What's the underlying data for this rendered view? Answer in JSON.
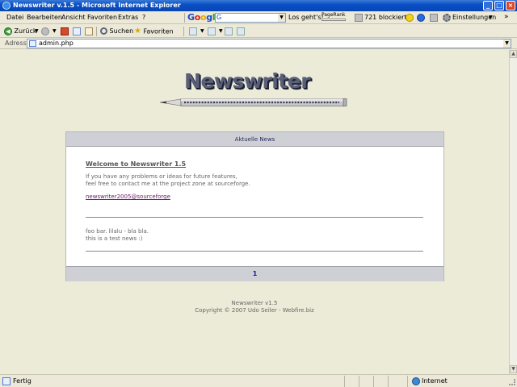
{
  "window": {
    "title": "Newswriter v.1.5 - Microsoft Internet Explorer",
    "minimize": "_",
    "maximize": "□",
    "close": "×"
  },
  "menu": {
    "items": [
      "Datei",
      "Bearbeiten",
      "Ansicht",
      "Favoriten",
      "Extras",
      "?"
    ]
  },
  "google_toolbar": {
    "logo": [
      "G",
      "o",
      "o",
      "g",
      "l",
      "e"
    ],
    "search_prefix": "G",
    "go_label": "Los geht's!",
    "pagerank_label": "PageRank",
    "popups_blocked": "721 blockiert",
    "settings_label": "Einstellungen"
  },
  "toolbar": {
    "back_label": "Zurück",
    "search_label": "Suchen",
    "favorites_label": "Favoriten"
  },
  "address": {
    "label": "Adresse",
    "url": "admin.php"
  },
  "page": {
    "logo_text": "Newswriter",
    "header": "Aktuelle News",
    "welcome_title": "Welcome to Newswriter 1.5",
    "welcome_lines": [
      "If you have any problems or ideas for future features,",
      "feel free to contact me at the project zone at sourceforge."
    ],
    "contact_link": "newswriter2005@sourceforge",
    "news_lines": [
      "foo bar. lilalu - bla bla.",
      "this is a test news :)"
    ],
    "page_number": "1",
    "footer_version": "Newswriter v1.5",
    "footer_copyright": "Copyright © 2007 Udo Seiler - Webfire.biz"
  },
  "status": {
    "text": "Fertig",
    "zone": "Internet"
  }
}
